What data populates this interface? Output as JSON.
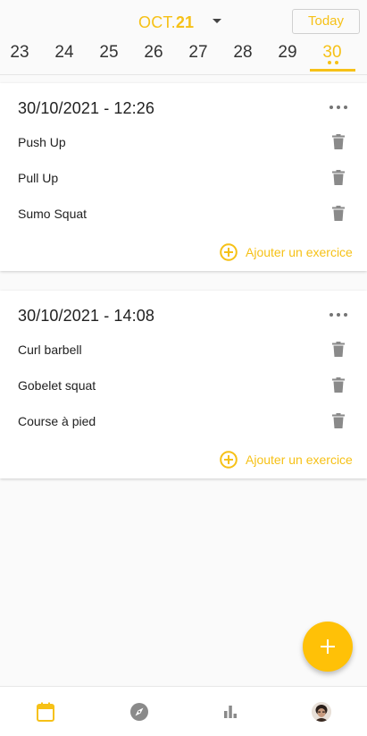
{
  "header": {
    "month_name": "OCT.",
    "month_year": "21",
    "today_label": "Today",
    "days": [
      "23",
      "24",
      "25",
      "26",
      "27",
      "28",
      "29",
      "30"
    ],
    "selected_day": "30"
  },
  "sessions": [
    {
      "title": "30/10/2021 - 12:26",
      "exercises": [
        "Push Up",
        "Pull Up",
        "Sumo Squat"
      ],
      "add_label": "Ajouter un exercice"
    },
    {
      "title": "30/10/2021 - 14:08",
      "exercises": [
        "Curl barbell",
        "Gobelet squat",
        "Course à pied"
      ],
      "add_label": "Ajouter un exercice"
    }
  ],
  "bottom_nav": {
    "items": [
      {
        "icon": "calendar-icon",
        "active": true
      },
      {
        "icon": "compass-icon",
        "active": false
      },
      {
        "icon": "bar-chart-icon",
        "active": false
      },
      {
        "icon": "avatar",
        "active": false
      }
    ]
  },
  "colors": {
    "accent": "#f6c117",
    "fab": "#ffc107",
    "icon_grey": "#8a8a8a"
  }
}
